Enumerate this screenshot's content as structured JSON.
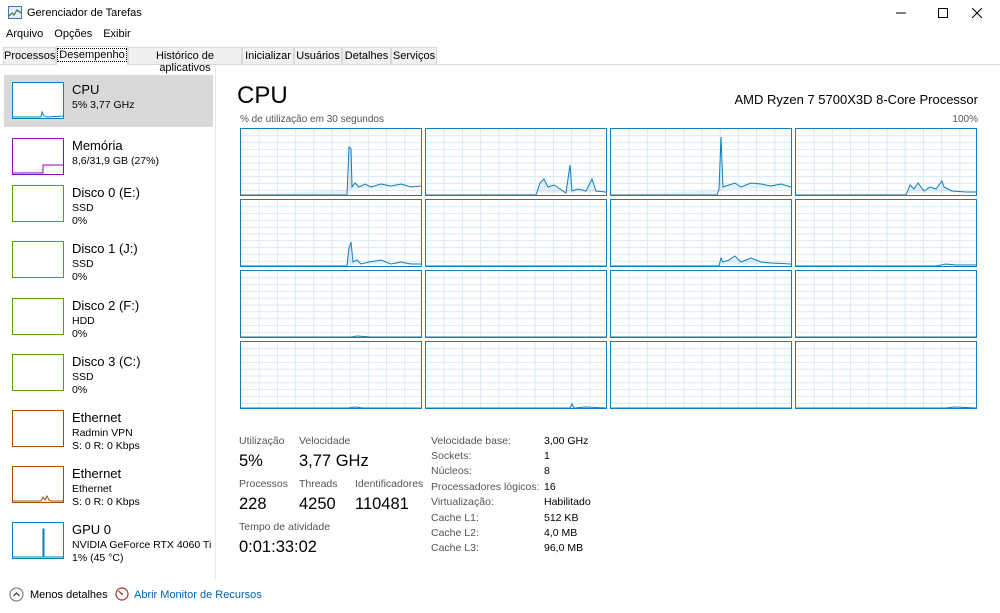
{
  "window": {
    "title": "Gerenciador de Tarefas"
  },
  "menu": [
    "Arquivo",
    "Opções",
    "Exibir"
  ],
  "tabs": [
    "Processos",
    "Desempenho",
    "Histórico de aplicativos",
    "Inicializar",
    "Usuários",
    "Detalhes",
    "Serviços"
  ],
  "active_tab": "Desempenho",
  "sidebar": {
    "items": [
      {
        "title": "CPU",
        "line2": "5% 3,77 GHz",
        "line3": "",
        "color": "#117dbb",
        "selected": true
      },
      {
        "title": "Memória",
        "line2": "8,6/31,9 GB (27%)",
        "line3": "",
        "color": "#8b12ae"
      },
      {
        "title": "Disco 0 (E:)",
        "line2": "SSD",
        "line3": "0%",
        "color": "#4da60c"
      },
      {
        "title": "Disco 1 (J:)",
        "line2": "SSD",
        "line3": "0%",
        "color": "#4da60c"
      },
      {
        "title": "Disco 2 (F:)",
        "line2": "HDD",
        "line3": "0%",
        "color": "#4da60c"
      },
      {
        "title": "Disco 3 (C:)",
        "line2": "SSD",
        "line3": "0%",
        "color": "#4da60c"
      },
      {
        "title": "Ethernet",
        "line2": "Radmin VPN",
        "line3": "S: 0 R: 0 Kbps",
        "color": "#a74f01"
      },
      {
        "title": "Ethernet",
        "line2": "Ethernet",
        "line3": "S: 0 R: 0 Kbps",
        "color": "#a74f01"
      },
      {
        "title": "GPU 0",
        "line2": "NVIDIA GeForce RTX 4060 Ti",
        "line3": "1% (45 °C)",
        "color": "#117dbb"
      }
    ]
  },
  "main": {
    "title": "CPU",
    "processor": "AMD Ryzen 7 5700X3D 8-Core Processor",
    "graph_caption": "% de utilização em 30 segundos",
    "graph_max": "100%",
    "stats": {
      "utilization_label": "Utilização",
      "utilization": "5%",
      "speed_label": "Velocidade",
      "speed": "3,77 GHz",
      "processes_label": "Processos",
      "processes": "228",
      "threads_label": "Threads",
      "threads": "4250",
      "handles_label": "Identificadores",
      "handles": "110481",
      "uptime_label": "Tempo de atividade",
      "uptime": "0:01:33:02"
    },
    "details": [
      {
        "key": "Velocidade base:",
        "value": "3,00 GHz"
      },
      {
        "key": "Sockets:",
        "value": "1"
      },
      {
        "key": "Núcleos:",
        "value": "8"
      },
      {
        "key": "Processadores lógicos:",
        "value": "16"
      },
      {
        "key": "Virtualização:",
        "value": "Habilitado"
      },
      {
        "key": "Cache L1:",
        "value": "512 KB"
      },
      {
        "key": "Cache L2:",
        "value": "4,0 MB"
      },
      {
        "key": "Cache L3:",
        "value": "96,0 MB"
      }
    ]
  },
  "footer": {
    "less_details": "Menos detalhes",
    "resource_monitor": "Abrir Monitor de Recursos"
  },
  "colors": {
    "cpu_line": "#117dbb",
    "grid_line": "#d9eaf4",
    "link": "#0063b1"
  }
}
